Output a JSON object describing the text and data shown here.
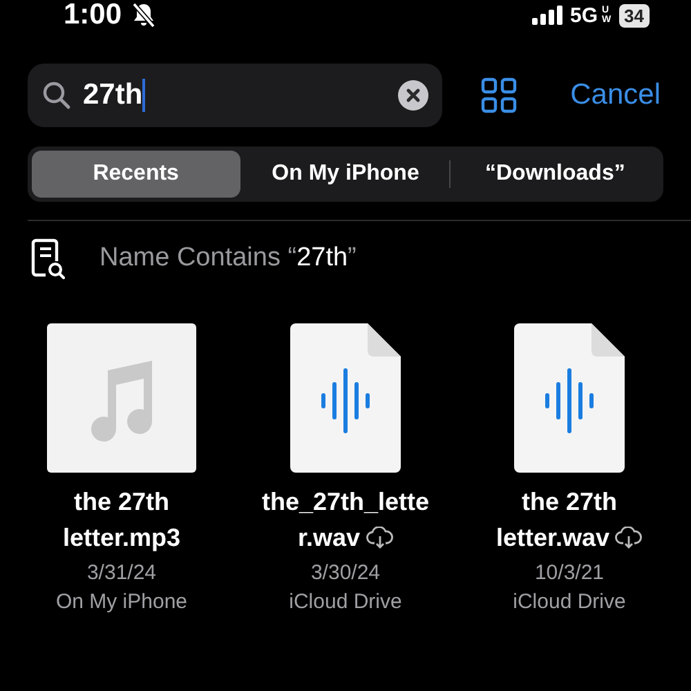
{
  "status_bar": {
    "time": "1:00",
    "silent": true,
    "network": "5G",
    "network_suffix": "UW",
    "battery": "34"
  },
  "search": {
    "value": "27th"
  },
  "cancel": "Cancel",
  "scopes": [
    {
      "label": "Recents",
      "selected": true
    },
    {
      "label": "On My iPhone",
      "selected": false
    },
    {
      "label": "“Downloads”",
      "selected": false
    }
  ],
  "suggestion": {
    "prefix": "Name Contains “",
    "term": "27th",
    "suffix": "”"
  },
  "files": [
    {
      "kind": "audio",
      "name_lines": [
        "the 27th",
        "letter.mp3"
      ],
      "in_cloud": false,
      "date": "3/31/24",
      "location": "On My iPhone"
    },
    {
      "kind": "wav",
      "name_lines": [
        "the_27th_lette",
        "r.wav"
      ],
      "in_cloud": true,
      "date": "3/30/24",
      "location": "iCloud Drive"
    },
    {
      "kind": "wav",
      "name_lines": [
        "the 27th",
        "letter.wav"
      ],
      "in_cloud": true,
      "date": "10/3/21",
      "location": "iCloud Drive"
    }
  ]
}
